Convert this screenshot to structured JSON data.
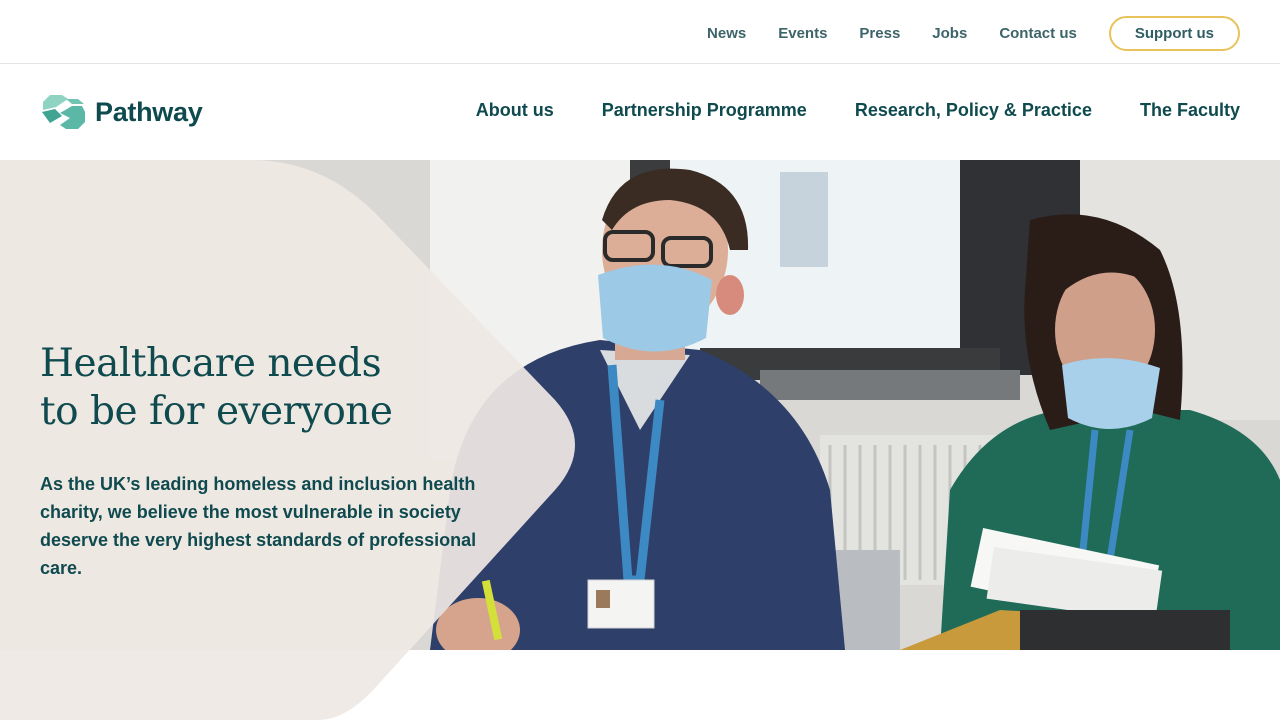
{
  "utility_nav": {
    "links": [
      "News",
      "Events",
      "Press",
      "Jobs",
      "Contact us"
    ],
    "support_label": "Support us"
  },
  "brand": {
    "name": "Pathway",
    "colors": {
      "primary": "#0f4a4f",
      "accent": "#5bb8a6",
      "button_border": "#e8c25a",
      "shape": "#efe8e4"
    }
  },
  "main_nav": {
    "items": [
      "About us",
      "Partnership Programme",
      "Research, Policy & Practice",
      "The Faculty"
    ]
  },
  "hero": {
    "title_line1": "Healthcare needs",
    "title_line2": "to be for everyone",
    "body": "As the UK’s leading homeless and inclusion health charity, we believe the most vulnerable in society deserve the very highest standards of professional care.",
    "image": "photo-icon"
  }
}
